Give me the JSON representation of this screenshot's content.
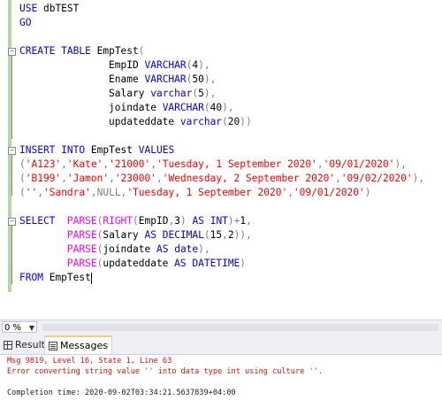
{
  "editor": {
    "lines": [
      {
        "t": "USE dbTEST"
      },
      {
        "t": "GO"
      },
      {
        "t": ""
      },
      {
        "t": "CREATE TABLE EmpTest("
      },
      {
        "t": "               EmpID VARCHAR(4),"
      },
      {
        "t": "               Ename VARCHAR(50),"
      },
      {
        "t": "               Salary varchar(5),"
      },
      {
        "t": "               joindate VARCHAR(40),"
      },
      {
        "t": "               updateddate varchar(20))"
      },
      {
        "t": ""
      },
      {
        "t": "INSERT INTO EmpTest VALUES"
      },
      {
        "t": "('A123','Kate','21000','Tuesday, 1 September 2020','09/01/2020'),"
      },
      {
        "t": "('B199','Jamon','23000','Wednesday, 2 September 2020','09/02/2020'),"
      },
      {
        "t": "('','Sandra',NULL,'Tuesday, 1 September 2020','09/01/2020')"
      },
      {
        "t": ""
      },
      {
        "t": "SELECT  PARSE(RIGHT(EmpID,3) AS INT)+1,"
      },
      {
        "t": "        PARSE(Salary AS DECIMAL(15,2)),"
      },
      {
        "t": "        PARSE(joindate AS date),"
      },
      {
        "t": "        PARSE(updateddate AS DATETIME)"
      },
      {
        "t": "FROM EmpTest"
      }
    ]
  },
  "status": {
    "zoom": "0 %"
  },
  "tabs": {
    "results_label": "Results",
    "messages_label": "Messages"
  },
  "messages": {
    "line1": "Msg 9819, Level 16, State 1, Line 63",
    "line2": "Error converting string value '' into data type int using culture ''.",
    "line3": "Completion time: 2020-09-02T03:34:21.5637839+04:00"
  },
  "colors": {
    "keyword": "#0000ff",
    "function": "#ff00ff",
    "string": "#ff0000",
    "operator": "#808080",
    "error": "#e01010"
  }
}
